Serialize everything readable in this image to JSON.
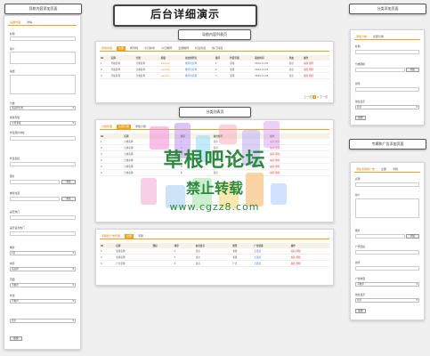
{
  "main_title": "后台详细演示",
  "labels": {
    "top_left": "导航内容添加页面",
    "list_page": "导航内容列表页",
    "category_list": "分类列表页",
    "top_right": "分类添加页面",
    "ad_add": "专辑和广告添加页面"
  },
  "left_form": {
    "tabs": [
      "基础内容",
      "详情"
    ],
    "fields": [
      "标题",
      "简介",
      "描述",
      "分类",
      "所属专辑",
      "外链图片地址",
      "外链链接",
      "图片",
      "推荐位置",
      "是否热门",
      "是否设为热门",
      "推荐",
      "排序",
      "页面",
      "状态"
    ],
    "selects": [
      "请选择分类",
      "全部专辑",
      "请选择",
      "请选择",
      "1星",
      "请选择",
      "不推荐",
      "不推荐",
      "显示"
    ],
    "upload_label": "浏览",
    "submit": "提交"
  },
  "list": {
    "tabs": [
      "导航内容",
      "全部",
      "按专辑",
      "今日新增",
      "今日推荐",
      "全部推荐",
      "标签筛选",
      "热门筛选"
    ],
    "headers": [
      "ID",
      "名称",
      "分类",
      "星级",
      "前台推荐位",
      "排序",
      "外链专辑",
      "添加时间",
      "状态",
      "操作"
    ],
    "rows": [
      [
        "1",
        "导航名称",
        "分类名称",
        "★★★★★",
        "推荐位名称",
        "1",
        "专辑",
        "2019-11-03",
        "显示",
        "编辑 删除"
      ],
      [
        "2",
        "导航名称",
        "分类名称",
        "★★★★★",
        "推荐位名称",
        "2",
        "专辑",
        "2019-11-03",
        "显示",
        "编辑 删除"
      ],
      [
        "3",
        "导航名称",
        "分类名称",
        "★★★★★",
        "推荐位名称",
        "3",
        "专辑",
        "2019-11-03",
        "显示",
        "编辑 删除"
      ]
    ],
    "pager": [
      "上一页",
      "1",
      "2",
      "下一页"
    ]
  },
  "categories": {
    "tabs": [
      "分类管理",
      "全部分类",
      "添加分类"
    ],
    "headers": [
      "ID",
      "名称",
      "排序",
      "前台推荐",
      "操作"
    ],
    "rows": [
      [
        "1",
        "分类名称",
        "1",
        "显示",
        "编辑 删除"
      ],
      [
        "2",
        "分类名称",
        "2",
        "显示",
        "编辑 删除"
      ],
      [
        "3",
        "分类名称",
        "3",
        "显示",
        "编辑 删除"
      ],
      [
        "4",
        "分类名称",
        "4",
        "显示",
        "编辑 删除"
      ],
      [
        "5",
        "分类名称",
        "5",
        "显示",
        "编辑 删除"
      ],
      [
        "6",
        "分类名称",
        "6",
        "显示",
        "编辑 删除"
      ]
    ],
    "ad_label": "专辑和广告添加页面"
  },
  "ads": {
    "tabs": [
      "专辑和广告管理",
      "全部",
      "专辑"
    ],
    "headers": [
      "ID",
      "名称",
      "图标",
      "排序",
      "前台显示",
      "类型",
      "广告链接",
      "操作"
    ],
    "rows": [
      [
        "1",
        "专辑名称",
        "",
        "1",
        "显示",
        "专辑",
        "无链接",
        "编辑 删除"
      ],
      [
        "2",
        "专辑名称",
        "",
        "2",
        "显示",
        "专辑",
        "无链接",
        "编辑 删除"
      ],
      [
        "3",
        "广告名称",
        "",
        "3",
        "显示",
        "广告",
        "无链接",
        "编辑 删除"
      ]
    ]
  },
  "right_top_form": {
    "tabs": [
      "添加分类",
      "全部分类"
    ],
    "fields": [
      "标题",
      "分类图标",
      "排序",
      "前台显示"
    ],
    "upload_label": "浏览",
    "select": "显示",
    "submit": "提交"
  },
  "right_bottom_form": {
    "tabs": [
      "添加专辑和广告",
      "全部",
      "专辑"
    ],
    "fields": [
      "名称",
      "简介",
      "图片",
      "广告链接",
      "排序",
      "广告类型",
      "前台显示"
    ],
    "upload_label": "浏览",
    "selects": [
      "不推荐",
      "显示"
    ],
    "submit": "提交"
  },
  "watermark": {
    "line1": "草根吧论坛",
    "line2": "禁止转载",
    "line3": "www.cgzz8.com"
  }
}
